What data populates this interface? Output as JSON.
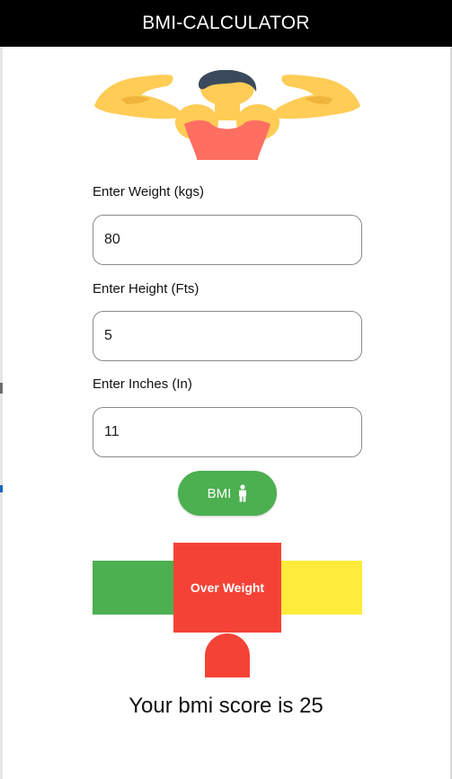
{
  "app_bar": {
    "title": "BMI-CALCULATOR"
  },
  "hero": {
    "icon": "bodybuilder-illustration",
    "colors": {
      "skin": "#ffcc55",
      "tank_top": "#ff6f61",
      "hair": "#3a4a5c"
    }
  },
  "form": {
    "weight": {
      "label": "Enter Weight (kgs)",
      "value": "80"
    },
    "height_ft": {
      "label": "Enter Height (Fts)",
      "value": "5"
    },
    "height_in": {
      "label": "Enter Inches (In)",
      "value": "11"
    },
    "bmi_button": {
      "label": "BMI",
      "icon": "person-icon",
      "color": "#4caf50"
    }
  },
  "gauge": {
    "segments": [
      {
        "name": "normal",
        "color": "#4caf50"
      },
      {
        "name": "over-weight",
        "label": "Over Weight",
        "color": "#f44336"
      },
      {
        "name": "obese",
        "color": "#ffeb3b"
      }
    ],
    "active_label": "Over Weight"
  },
  "result": {
    "text": "Your bmi score is 25"
  }
}
